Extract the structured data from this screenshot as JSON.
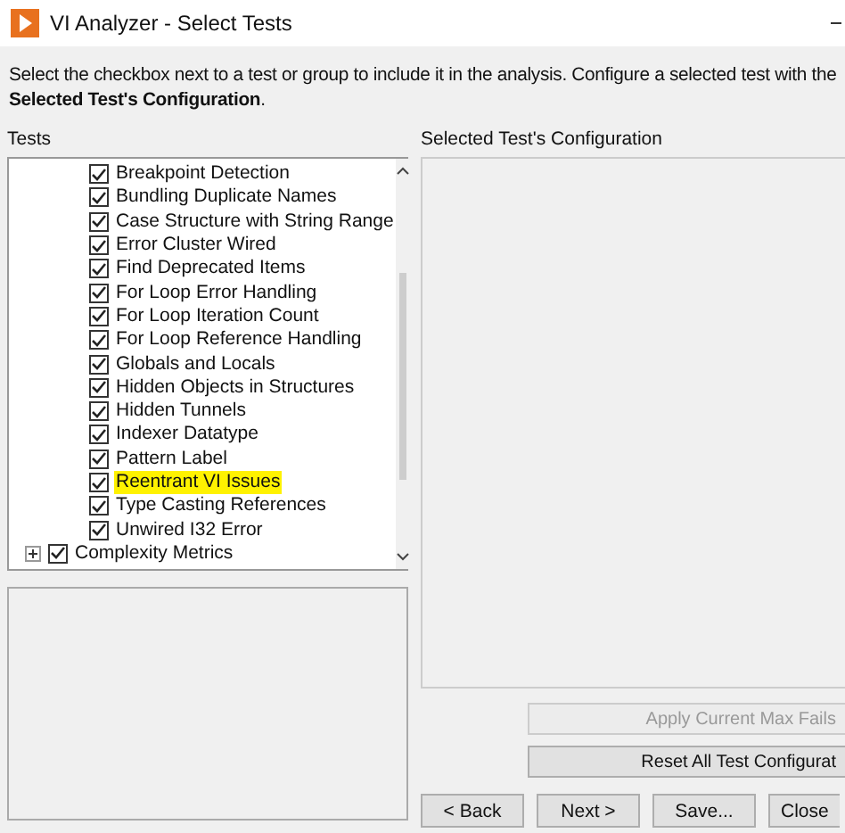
{
  "window": {
    "title": "VI Analyzer - Select Tests"
  },
  "instructions": "Select the checkbox next to a test or group to include it in the analysis.  Configure a selected test with the **Selected Test's Configuration**.",
  "tests_label": "Tests",
  "tests": [
    {
      "label": "Breakpoint Detection",
      "checked": true,
      "highlighted": false
    },
    {
      "label": "Bundling Duplicate Names",
      "checked": true,
      "highlighted": false
    },
    {
      "label": "Case Structure with String Range",
      "checked": true,
      "highlighted": false
    },
    {
      "label": "Error Cluster Wired",
      "checked": true,
      "highlighted": false
    },
    {
      "label": "Find Deprecated Items",
      "checked": true,
      "highlighted": false
    },
    {
      "label": "For Loop Error Handling",
      "checked": true,
      "highlighted": false
    },
    {
      "label": "For Loop Iteration Count",
      "checked": true,
      "highlighted": false
    },
    {
      "label": "For Loop Reference Handling",
      "checked": true,
      "highlighted": false
    },
    {
      "label": "Globals and Locals",
      "checked": true,
      "highlighted": false
    },
    {
      "label": "Hidden Objects in Structures",
      "checked": true,
      "highlighted": false
    },
    {
      "label": "Hidden Tunnels",
      "checked": true,
      "highlighted": false
    },
    {
      "label": "Indexer Datatype",
      "checked": true,
      "highlighted": false
    },
    {
      "label": "Pattern Label",
      "checked": true,
      "highlighted": false
    },
    {
      "label": "Reentrant VI Issues",
      "checked": true,
      "highlighted": true
    },
    {
      "label": "Type Casting References",
      "checked": true,
      "highlighted": false
    },
    {
      "label": "Unwired I32 Error",
      "checked": true,
      "highlighted": false
    }
  ],
  "groups": [
    {
      "label": "Complexity Metrics",
      "checked": true,
      "expanded": false
    }
  ],
  "config_label": "Selected Test's Configuration",
  "side_buttons": [
    {
      "label": "Apply Current Max Fails",
      "disabled": true
    },
    {
      "label": "Reset All Test Configurat",
      "disabled": false
    }
  ],
  "buttons": [
    "< Back",
    "Next >",
    "Save...",
    "Close"
  ]
}
